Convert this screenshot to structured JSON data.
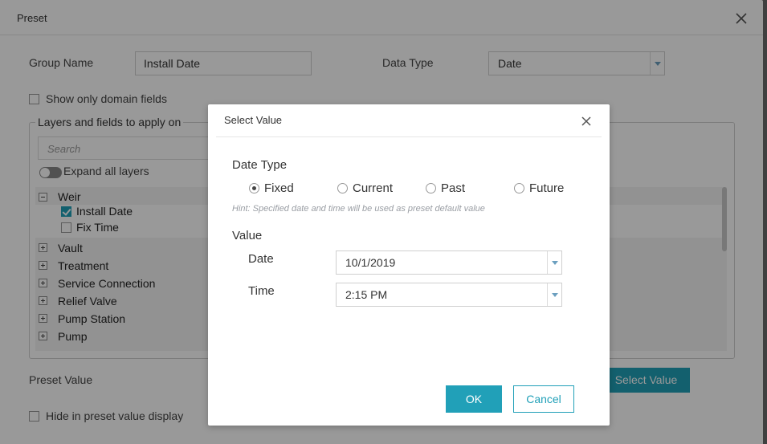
{
  "outer": {
    "title": "Preset",
    "group_name_label": "Group Name",
    "group_name_value": "Install Date",
    "data_type_label": "Data Type",
    "data_type_value": "Date",
    "show_domain_label": "Show only domain fields",
    "layers_legend": "Layers and fields to apply on",
    "search_placeholder": "Search",
    "expand_all_label": "Expand all layers",
    "layers": [
      {
        "name": "Weir",
        "expanded": true,
        "fields": [
          {
            "name": "Install Date",
            "checked": true
          },
          {
            "name": "Fix Time",
            "checked": false
          }
        ]
      },
      {
        "name": "Vault"
      },
      {
        "name": "Treatment"
      },
      {
        "name": "Service Connection"
      },
      {
        "name": "Relief Valve"
      },
      {
        "name": "Pump Station"
      },
      {
        "name": "Pump"
      }
    ],
    "preset_value_label": "Preset Value",
    "select_value_button": "Select Value",
    "hide_preset_label": "Hide in preset value display"
  },
  "dialog": {
    "title": "Select Value",
    "date_type_heading": "Date Type",
    "options": [
      "Fixed",
      "Current",
      "Past",
      "Future"
    ],
    "selected_option": "Fixed",
    "hint": "Hint: Specified date and time will be used as preset default value",
    "value_heading": "Value",
    "date_label": "Date",
    "date_value": "10/1/2019",
    "time_label": "Time",
    "time_value": "2:15 PM",
    "ok_label": "OK",
    "cancel_label": "Cancel"
  },
  "colors": {
    "accent": "#21a0b8",
    "overlay": "#000000"
  }
}
